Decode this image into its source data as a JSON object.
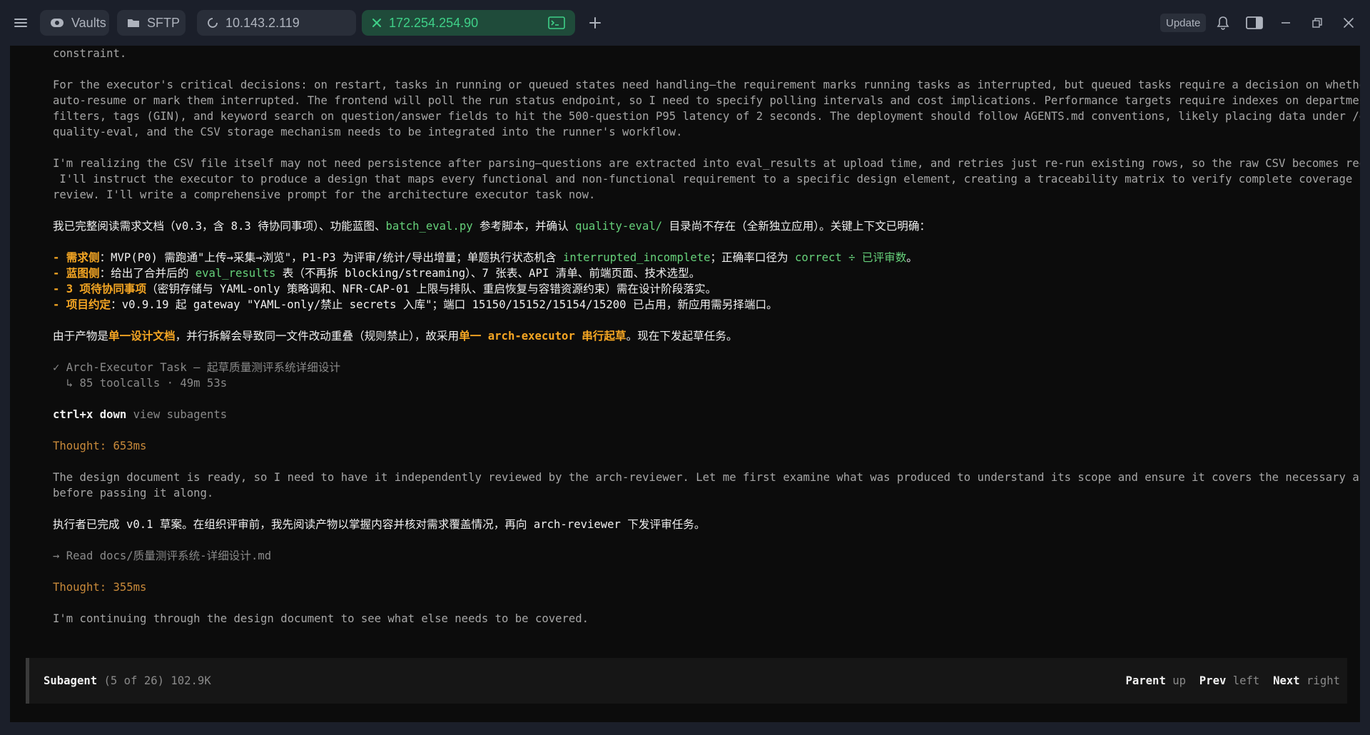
{
  "titlebar": {
    "menu_icon": "hamburger-icon",
    "tabs": [
      {
        "label": "Vaults",
        "icon": "vault-icon"
      },
      {
        "label": "SFTP",
        "icon": "folder-icon"
      },
      {
        "label": "10.143.2.119",
        "icon": "loading-icon"
      },
      {
        "label": "172.254.254.90",
        "icon": "close-icon",
        "right_icon": "terminal-icon",
        "active": true
      }
    ],
    "new_tab_icon": "plus-icon",
    "update_label": "Update",
    "right_icons": [
      "bell-icon",
      "sidebar-toggle-icon",
      "minimize-icon",
      "restore-icon",
      "close-window-icon"
    ]
  },
  "colors": {
    "accent_green": "#3fd088",
    "orange": "#f5a623",
    "text_green": "#66d17a"
  },
  "terminal": {
    "l01": "constraint.",
    "l02": "For the executor's critical decisions: on restart, tasks in running or queued states need handling—the requirement marks running tasks as interrupted, but queued tasks require a decision on whether to",
    "l03": "auto-resume or mark them interrupted. The frontend will poll the run status endpoint, so I need to specify polling intervals and cost implications. Performance targets require indexes on department",
    "l04": "filters, tags (GIN), and keyword search on question/answer fields to hit the 500-question P95 latency of 2 seconds. The deployment should follow AGENTS.md conventions, likely placing data under /data/",
    "l05": "quality-eval, and the CSV storage mechanism needs to be integrated into the runner's workflow.",
    "l06": "I'm realizing the CSV file itself may not need persistence after parsing—questions are extracted into eval_results at upload time, and retries just re-run existing rows, so the raw CSV becomes redundant.",
    "l07": " I'll instruct the executor to produce a design that maps every functional and non-functional requirement to a specific design element, creating a traceability matrix to verify complete coverage before",
    "l08": "review. I'll write a comprehensive prompt for the architecture executor task now.",
    "l09a": "我已完整阅读需求文档（v0.3，含 8.3 待协同事项）、功能蓝图、",
    "l09b": "batch_eval.py",
    "l09c": " 参考脚本，并确认 ",
    "l09d": "quality-eval/",
    "l09e": " 目录尚不存在（全新独立应用）。关键上下文已明确：",
    "l10a": "- 需求侧",
    "l10b": "：MVP(P0) 需跑通\"上传→采集→浏览\"，P1-P3 为评审/统计/导出增量；单题执行状态机含 ",
    "l10c": "interrupted_incomplete",
    "l10d": "；正确率口径为 ",
    "l10e": "correct ÷ 已评审数",
    "l10f": "。",
    "l11a": "- 蓝图侧",
    "l11b": "：给出了合并后的 ",
    "l11c": "eval_results",
    "l11d": " 表（不再拆 blocking/streaming）、7 张表、API 清单、前端页面、技术选型。",
    "l12a": "- 3 项待协同事项",
    "l12b": "（密钥存储与 YAML-only 策略调和、NFR-CAP-01 上限与排队、重启恢复与容错资源约束）需在设计阶段落实。",
    "l13a": "- 项目约定",
    "l13b": "：v0.9.19 起 gateway \"YAML-only/禁止 secrets 入库\"；端口 15150/15152/15154/15200 已占用，新应用需另择端口。",
    "l14a": "由于产物是",
    "l14b": "单一设计文档",
    "l14c": "，并行拆解会导致同一文件改动重叠（规则禁止），故采用",
    "l14d": "单一 arch-executor 串行起草",
    "l14e": "。现在下发起草任务。",
    "l15": "✓ Arch-Executor Task — 起草质量测评系统详细设计",
    "l16": "  ↳ 85 toolcalls · 49m 53s",
    "l17a": "ctrl+x down",
    "l17b": " view subagents",
    "l18": "Thought: 653ms",
    "l19": "The design document is ready, so I need to have it independently reviewed by the arch-reviewer. Let me first examine what was produced to understand its scope and ensure it covers the necessary areas",
    "l20": "before passing it along.",
    "l21": "执行者已完成 v0.1 草案。在组织评审前，我先阅读产物以掌握内容并核对需求覆盖情况，再向 arch-reviewer 下发评审任务。",
    "l22": "→ Read docs/质量测评系统-详细设计.md",
    "l23": "Thought: 355ms",
    "l24": "I'm continuing through the design document to see what else needs to be covered."
  },
  "footer": {
    "title": "Subagent",
    "meta": " (5 of 26) 102.9K",
    "parent": "Parent",
    "parent_key": " up",
    "prev": "Prev",
    "prev_key": " left",
    "next": "Next",
    "next_key": " right"
  }
}
